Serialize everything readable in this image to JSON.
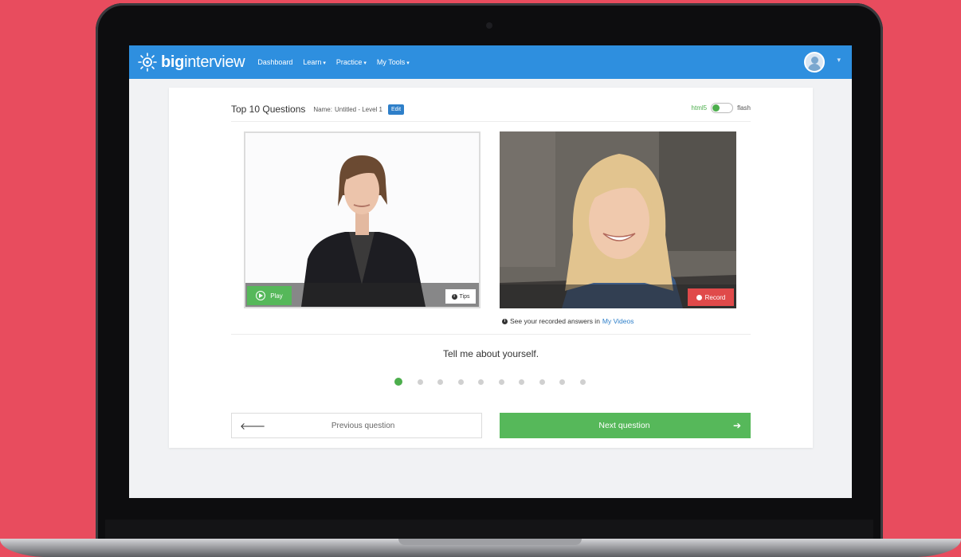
{
  "nav": {
    "logo_bold": "big",
    "logo_light": "interview",
    "items": [
      {
        "label": "Dashboard",
        "caret": ""
      },
      {
        "label": "Learn",
        "caret": "▾"
      },
      {
        "label": "Practice",
        "caret": "▾"
      },
      {
        "label": "My Tools",
        "caret": "▾"
      }
    ],
    "avatar_caret": "▾"
  },
  "card": {
    "title": "Top 10 Questions",
    "name_label": "Name:",
    "name_value": "Untitled - Level 1",
    "edit_label": "Edit",
    "mode_html5": "html5",
    "mode_flash": "flash"
  },
  "videos": {
    "play_label": "Play",
    "tips_label": "Tips",
    "record_label": "Record",
    "info_glyph": "i"
  },
  "recorded_note": {
    "text": "See your recorded answers in",
    "link": "My Videos"
  },
  "question": "Tell me about yourself.",
  "progress": {
    "current": 1,
    "total": 10
  },
  "buttons": {
    "prev_label": "Previous question",
    "prev_arrow": "🡐",
    "next_label": "Next question",
    "next_arrow": "➔"
  },
  "colors": {
    "background": "#e84c5e",
    "navbar": "#2e8fdf",
    "green": "#56b85a",
    "record_red": "#e04a4a",
    "link_blue": "#2e7fc9"
  }
}
